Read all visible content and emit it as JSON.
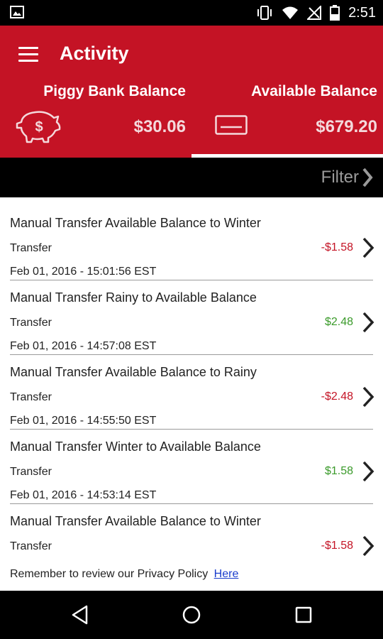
{
  "status_bar": {
    "time": "2:51",
    "icons": [
      "image-icon",
      "vibrate-icon",
      "wifi-icon",
      "signal-icon",
      "battery-icon"
    ]
  },
  "header": {
    "title": "Activity",
    "background_color": "#c41325",
    "piggy": {
      "label": "Piggy Bank Balance",
      "value": "$30.06",
      "icon": "piggy-bank-icon"
    },
    "available": {
      "label": "Available Balance",
      "value": "$679.20",
      "icon": "card-icon"
    }
  },
  "filter": {
    "label": "Filter"
  },
  "transactions": [
    {
      "title": "Manual Transfer Available Balance to Winter",
      "type": "Transfer",
      "amount": "-$1.58",
      "date": "Feb 01, 2016 - 15:01:56 EST"
    },
    {
      "title": "Manual Transfer Rainy to Available Balance",
      "type": "Transfer",
      "amount": "$2.48",
      "date": "Feb 01, 2016 - 14:57:08 EST"
    },
    {
      "title": "Manual Transfer Available Balance to Rainy",
      "type": "Transfer",
      "amount": "-$2.48",
      "date": "Feb 01, 2016 - 14:55:50 EST"
    },
    {
      "title": "Manual Transfer Winter to Available Balance",
      "type": "Transfer",
      "amount": "$1.58",
      "date": "Feb 01, 2016 - 14:53:14 EST"
    },
    {
      "title": "Manual Transfer Available Balance to Winter",
      "type": "Transfer",
      "amount": "-$1.58",
      "date": ""
    }
  ],
  "colors": {
    "negative": "#c41325",
    "positive": "#3a9a2a",
    "link": "#1a3ccc"
  },
  "footer": {
    "privacy_text": "Remember to review our Privacy Policy",
    "privacy_link": "Here"
  },
  "nav": {
    "icons": [
      "back-icon",
      "home-icon",
      "recents-icon"
    ]
  }
}
